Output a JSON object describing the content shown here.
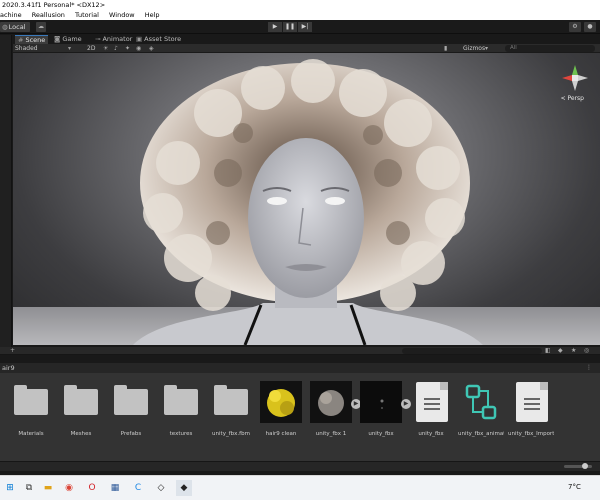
{
  "window": {
    "title": "2020.3.41f1 Personal* <DX12>"
  },
  "menu": [
    "achine",
    "Reallusion",
    "Tutorial",
    "Window",
    "Help"
  ],
  "toolbar": {
    "pivot_label": "Local"
  },
  "scene_tabs": [
    "Scene",
    "Game",
    "Animator",
    "Asset Store"
  ],
  "scene_toolbar": {
    "draw_mode": "Shaded",
    "mode_2d": "2D",
    "gizmos_label": "Gizmos",
    "search_placeholder": "All"
  },
  "viewport": {
    "projection_label": "< Persp"
  },
  "project": {
    "breadcrumb": "air9",
    "assets": [
      {
        "name": "Materials",
        "kind": "folder"
      },
      {
        "name": "Meshes",
        "kind": "folder"
      },
      {
        "name": "Prefabs",
        "kind": "folder"
      },
      {
        "name": "textures",
        "kind": "folder"
      },
      {
        "name": "unity_fbx.fbm",
        "kind": "folder"
      },
      {
        "name": "hair9 clean",
        "kind": "texture-yellow"
      },
      {
        "name": "unity_fbx 1",
        "kind": "texture-grey"
      },
      {
        "name": "unity_fbx",
        "kind": "model-dark"
      },
      {
        "name": "unity_fbx",
        "kind": "document"
      },
      {
        "name": "unity_fbx_animat...",
        "kind": "animator"
      },
      {
        "name": "unity_fbx_Importi...",
        "kind": "document"
      }
    ]
  },
  "taskbar": {
    "temperature": "7°C"
  },
  "colors": {
    "accent": "#3a79bb",
    "editor_bg": "#191919",
    "asset_panel": "#333333"
  }
}
